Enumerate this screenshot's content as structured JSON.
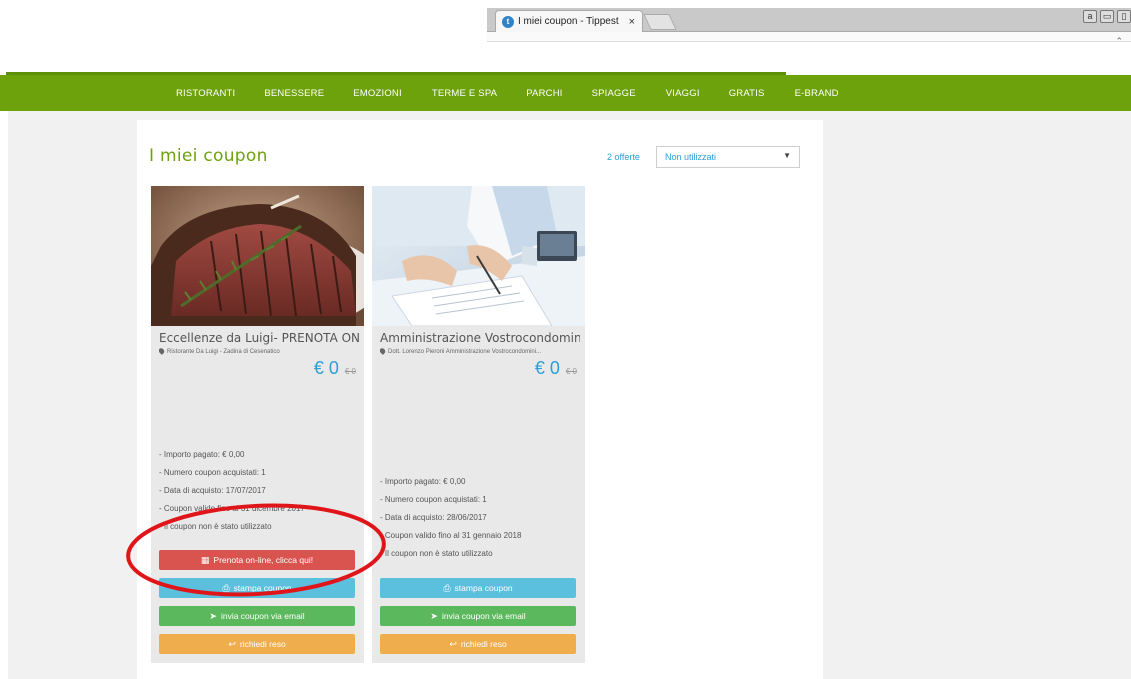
{
  "browser": {
    "tab_title": "I miei coupon - Tippest",
    "tab_close": "×",
    "favicon_letter": "t",
    "window_buttons": [
      "a",
      "▭",
      "▯"
    ],
    "scroll_arrow": "⌃"
  },
  "nav": {
    "items": [
      "RISTORANTI",
      "BENESSERE",
      "EMOZIONI",
      "TERME E SPA",
      "PARCHI",
      "SPIAGGE",
      "VIAGGI",
      "GRATIS",
      "E-BRAND"
    ],
    "color": "#6ea20c"
  },
  "page": {
    "title": "I miei coupon",
    "offers_count": "2 offerte",
    "filter_selected": "Non utilizzati"
  },
  "coupons": [
    {
      "title": "Eccellenze da Luigi- PRENOTA ONLINE!",
      "location": "Ristorante Da Luigi - Zadina di Cesenatico",
      "price": "€ 0",
      "old_price": "€ 0",
      "details": [
        "- Importo pagato: € 0,00",
        "- Numero coupon acquistati: 1",
        "- Data di acquisto: 17/07/2017",
        "- Coupon valido fino al 31 dicembre 2017",
        "- Il coupon non è stato utilizzato"
      ],
      "book_label": "Prenota on-line, clicca qui!",
      "print_label": "stampa coupon",
      "email_label": "invia coupon via email",
      "refund_label": "richiedi reso"
    },
    {
      "title": "Amministrazione Vostrocondominio e ...",
      "location": "Dott. Lorenzo Pieroni Amministrazione Vostrocondomini...",
      "price": "€ 0",
      "old_price": "€ 0",
      "details": [
        "- Importo pagato: € 0,00",
        "- Numero coupon acquistati: 1",
        "- Data di acquisto: 28/06/2017",
        "- Coupon valido fino al 31 gennaio 2018",
        "- Il coupon non è stato utilizzato"
      ],
      "print_label": "stampa coupon",
      "email_label": "invia coupon via email",
      "refund_label": "richiedi reso"
    }
  ],
  "colors": {
    "accent_blue": "#2a9fd6",
    "btn_red": "#d9534f",
    "btn_blue": "#5bc0de",
    "btn_green": "#5cb85c",
    "btn_orange": "#f0ad4e",
    "annotation": "#e0151a"
  }
}
